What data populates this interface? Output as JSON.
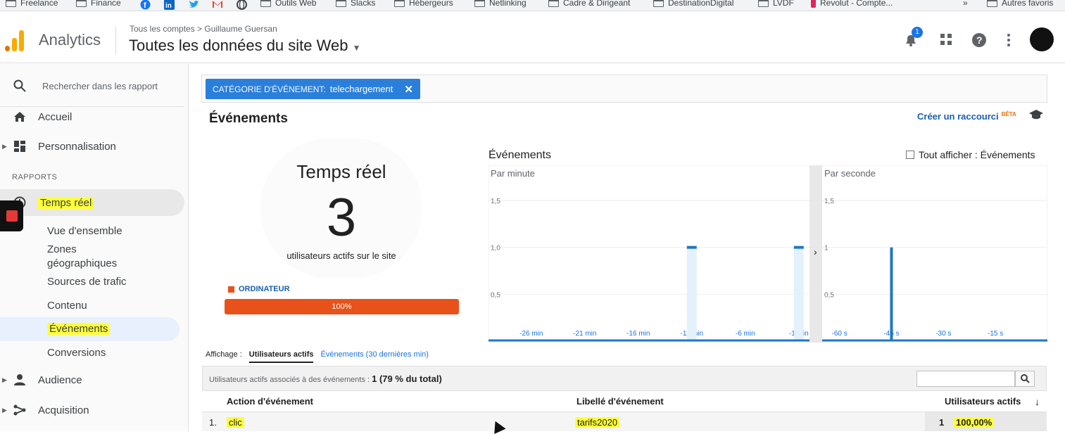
{
  "bookmarks": {
    "items": [
      {
        "label": "Freelance",
        "icon": "folder-icon"
      },
      {
        "label": "Finance",
        "icon": "folder-icon"
      },
      {
        "label": "",
        "icon": "facebook-icon"
      },
      {
        "label": "",
        "icon": "linkedin-icon"
      },
      {
        "label": "",
        "icon": "twitter-icon"
      },
      {
        "label": "",
        "icon": "gmail-icon"
      },
      {
        "label": "",
        "icon": "globe-icon"
      },
      {
        "label": "Outils Web",
        "icon": "folder-icon"
      },
      {
        "label": "Slacks",
        "icon": "folder-icon"
      },
      {
        "label": "Hébergeurs",
        "icon": "folder-icon"
      },
      {
        "label": "Netlinking",
        "icon": "folder-icon"
      },
      {
        "label": "Cadre & Dirigeant",
        "icon": "folder-icon"
      },
      {
        "label": "DestinationDigital",
        "icon": "folder-icon"
      },
      {
        "label": "LVDF",
        "icon": "folder-icon"
      },
      {
        "label": "Revolut - Compte...",
        "icon": "revolut-icon"
      }
    ],
    "overflow": "»",
    "other": "Autres favoris"
  },
  "header": {
    "app_name": "Analytics",
    "breadcrumb": "Tous les comptes > Guillaume Guersan",
    "account_view": "Toutes les données du site Web",
    "notification_count": "1",
    "accent": "#f9ab00"
  },
  "sidebar": {
    "search_placeholder": "Rechercher dans les rapport",
    "home": "Accueil",
    "customization": "Personnalisation",
    "section": "RAPPORTS",
    "realtime": "Temps réel",
    "sub": [
      "Vue d'ensemble",
      "Zones géographiques",
      "Sources de trafic",
      "Contenu",
      "Événements",
      "Conversions"
    ],
    "audience": "Audience",
    "acquisition": "Acquisition"
  },
  "filter": {
    "key": "CATÉGORIE D'ÉVÉNEMENT:",
    "value": "telechargement",
    "color": "#2a7fdb"
  },
  "card": {
    "title": "Événements",
    "shortcut": "Créer un raccourci",
    "beta": "BÊTA"
  },
  "realtime": {
    "title": "Temps réel",
    "active_users": "3",
    "subtitle": "utilisateurs actifs sur le site",
    "device_label": "ORDINATEUR",
    "device_percent": "100%",
    "device_share": 1.0,
    "device_color": "#e8521a"
  },
  "chart_data": [
    {
      "type": "bar",
      "title": "Événements",
      "subtitle": "Par minute",
      "x": [
        "-26 min",
        "-21 min",
        "-16 min",
        "-11 min",
        "-6 min",
        "-1 min"
      ],
      "bars": [
        {
          "x": -11,
          "y": 1.0
        },
        {
          "x": -1,
          "y": 1.0
        }
      ],
      "ylim": [
        0,
        1.5
      ],
      "yticks": [
        "0,5",
        "1,0",
        "1,5"
      ],
      "color": "#1f77c6"
    },
    {
      "type": "bar",
      "subtitle": "Par seconde",
      "x": [
        "-60 s",
        "-45 s",
        "-30 s",
        "-15 s"
      ],
      "bars": [
        {
          "x": -45,
          "y": 1.0
        }
      ],
      "ylim": [
        0,
        1.5
      ],
      "yticks": [
        "0,5",
        "1",
        "1,5"
      ],
      "color": "#1f77c6"
    }
  ],
  "chart_header": {
    "title": "Événements",
    "show_all": "Tout afficher : Événements"
  },
  "view_tabs": {
    "label": "Affichage :",
    "active": "Utilisateurs actifs",
    "inactive": "Événements (30 dernières min)"
  },
  "table": {
    "summary_label": "Utilisateurs actifs associés à des événements :",
    "summary_value": "1 (79 % du total)",
    "columns": [
      "Action d'événement",
      "Libellé d'événement",
      "Utilisateurs actifs"
    ],
    "rows": [
      {
        "index": "1.",
        "action": "clic",
        "label": "tarifs2020",
        "users": "1",
        "percent": "100,00%"
      }
    ]
  }
}
